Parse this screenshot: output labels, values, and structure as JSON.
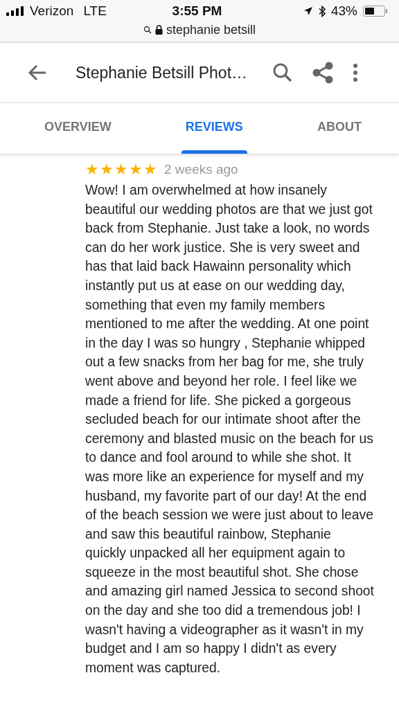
{
  "status_bar": {
    "carrier": "Verizon",
    "network": "LTE",
    "time": "3:55 PM",
    "battery": "43%",
    "url": "stephanie betsill"
  },
  "header": {
    "title": "Stephanie Betsill Phot…"
  },
  "tabs": [
    {
      "label": "OVERVIEW",
      "selected": false
    },
    {
      "label": "REVIEWS",
      "selected": true
    },
    {
      "label": "ABOUT",
      "selected": false
    }
  ],
  "review": {
    "stars": 5,
    "time": "2 weeks ago",
    "text": "Wow! I am overwhelmed at how insanely beautiful our wedding photos are that we just got back from Stephanie. Just take a look, no words can do her work justice. She is very sweet and has that laid back Hawainn personality which instantly put us at ease on our wedding day, something that even my family members mentioned to me after the wedding. At one point in the day I was so hungry , Stephanie whipped out a few snacks from her bag for me, she truly went above and beyond her role. I feel like we made a friend for life. She picked a gorgeous secluded beach for our intimate shoot after the ceremony and blasted music on the beach for us to dance and fool around to while she shot. It was more like an experience for myself and my husband, my favorite part of our day! At the end of the beach session we were just about to leave and saw this beautiful rainbow, Stephanie quickly unpacked all her equipment again to squeeze in the most beautiful shot. She chose and amazing girl named Jessica to second shoot on the day and she too did a tremendous job! I wasn't having a videographer as it wasn't in my budget and I am so happy I didn't as every moment was captured."
  }
}
